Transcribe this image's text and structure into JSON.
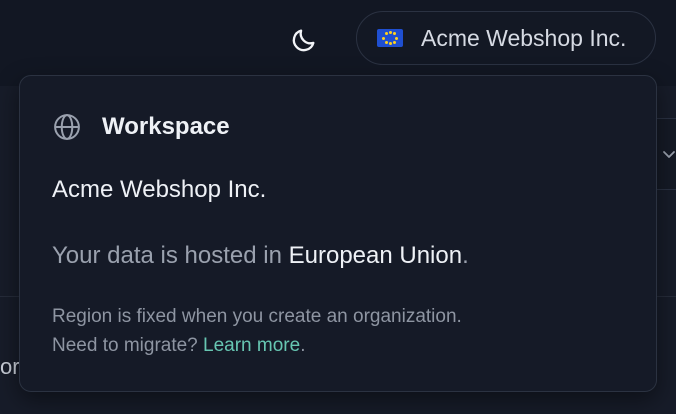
{
  "topbar": {
    "theme_toggle_icon": "moon-icon",
    "org_switcher": {
      "flag_icon": "eu-flag-icon",
      "label": "Acme Webshop Inc."
    }
  },
  "background": {
    "fragment_text": "or",
    "select_chevron_icon": "chevron-down-icon"
  },
  "popover": {
    "icon": "globe-icon",
    "title": "Workspace",
    "org_name": "Acme Webshop Inc.",
    "hosted_prefix": "Your data is hosted in ",
    "hosted_region": "European Union",
    "hosted_suffix": ".",
    "note_line1": "Region is fixed when you create an organization.",
    "note_line2_prefix": "Need to migrate? ",
    "learn_more": "Learn more",
    "note_line2_suffix": "."
  },
  "colors": {
    "background": "#121723",
    "popover_bg": "#151a27",
    "primary_text": "#eef1f6",
    "secondary_text": "#9aa1ae",
    "link": "#67c6b2",
    "flag_blue": "#1f4fd1",
    "flag_star": "#ffd21f"
  }
}
